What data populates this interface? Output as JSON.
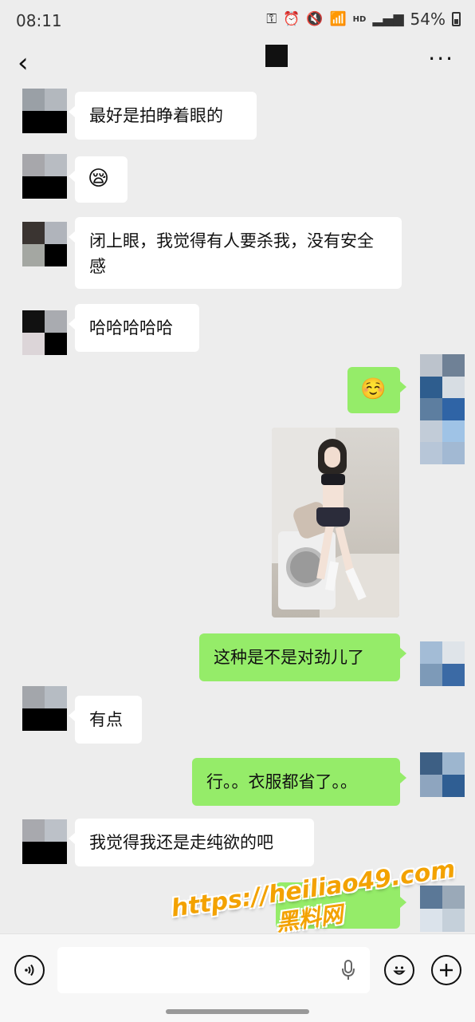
{
  "status_bar": {
    "time": "08:11",
    "battery": "54%",
    "hd": "HD"
  },
  "header": {
    "back_icon": "chevron-left-icon",
    "more_icon": "more-horizontal-icon"
  },
  "messages": [
    {
      "side": "in",
      "text": "最好是拍睁着眼的"
    },
    {
      "side": "in",
      "text": "😪"
    },
    {
      "side": "in",
      "text": "闭上眼，我觉得有人要杀我，没有安全感"
    },
    {
      "side": "in",
      "text": "哈哈哈哈哈"
    },
    {
      "side": "out",
      "text": "☺️"
    },
    {
      "side": "out",
      "type": "image"
    },
    {
      "side": "out",
      "text": "这种是不是对劲儿了"
    },
    {
      "side": "in",
      "text": "有点"
    },
    {
      "side": "out",
      "text": "行。。衣服都省了。。"
    },
    {
      "side": "in",
      "text": "我觉得我还是走纯欲的吧"
    },
    {
      "side": "out",
      "text": ""
    }
  ],
  "watermark": {
    "line1": "https://heiliao49.com",
    "line2": "黑料网"
  },
  "input_bar": {
    "voice_icon": "voice-icon",
    "mic_icon": "mic-icon",
    "emoji_icon": "emoji-icon",
    "plus_icon": "plus-icon"
  },
  "colors": {
    "background": "#ededed",
    "bubble_in": "#ffffff",
    "bubble_out": "#95ec69",
    "watermark": "#f3a200"
  }
}
